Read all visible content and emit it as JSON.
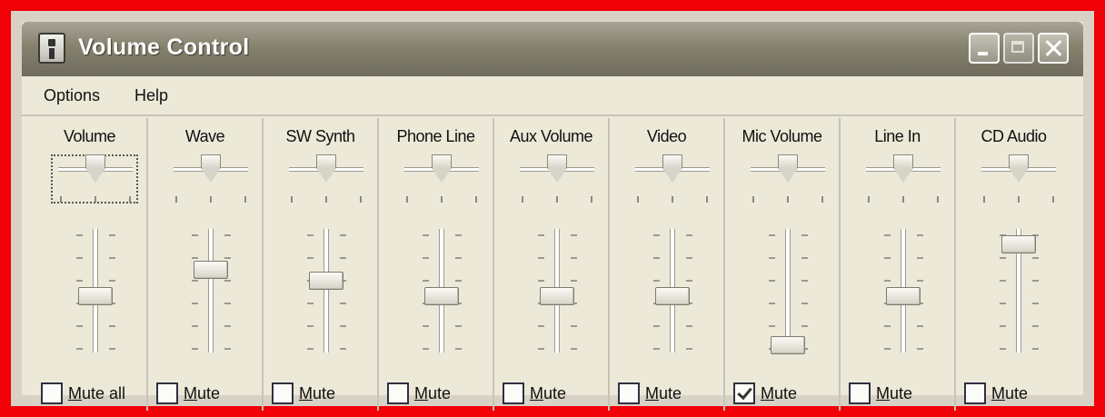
{
  "window": {
    "title": "Volume Control",
    "accent_border_color": "#f20007",
    "icons": [
      "app-icon",
      "minimize-icon",
      "maximize-icon",
      "close-icon"
    ]
  },
  "menu": {
    "options": "Options",
    "help": "Help"
  },
  "channels": [
    {
      "name": "Volume",
      "mute_label": "Mute all",
      "muted": false,
      "volume_level": 0.48,
      "balance": 0.0,
      "focused": true
    },
    {
      "name": "Wave",
      "mute_label": "Mute",
      "muted": false,
      "volume_level": 0.73,
      "balance": 0.0,
      "focused": false
    },
    {
      "name": "SW Synth",
      "mute_label": "Mute",
      "muted": false,
      "volume_level": 0.63,
      "balance": 0.0,
      "focused": false
    },
    {
      "name": "Phone Line",
      "mute_label": "Mute",
      "muted": false,
      "volume_level": 0.48,
      "balance": 0.0,
      "focused": false
    },
    {
      "name": "Aux Volume",
      "mute_label": "Mute",
      "muted": false,
      "volume_level": 0.48,
      "balance": 0.0,
      "focused": false
    },
    {
      "name": "Video",
      "mute_label": "Mute",
      "muted": false,
      "volume_level": 0.48,
      "balance": 0.0,
      "focused": false
    },
    {
      "name": "Mic Volume",
      "mute_label": "Mute",
      "muted": true,
      "volume_level": 0.02,
      "balance": 0.0,
      "focused": false
    },
    {
      "name": "Line In",
      "mute_label": "Mute",
      "muted": false,
      "volume_level": 0.48,
      "balance": 0.0,
      "focused": false
    },
    {
      "name": "CD Audio",
      "mute_label": "Mute",
      "muted": false,
      "volume_level": 0.97,
      "balance": 0.0,
      "focused": false
    }
  ]
}
